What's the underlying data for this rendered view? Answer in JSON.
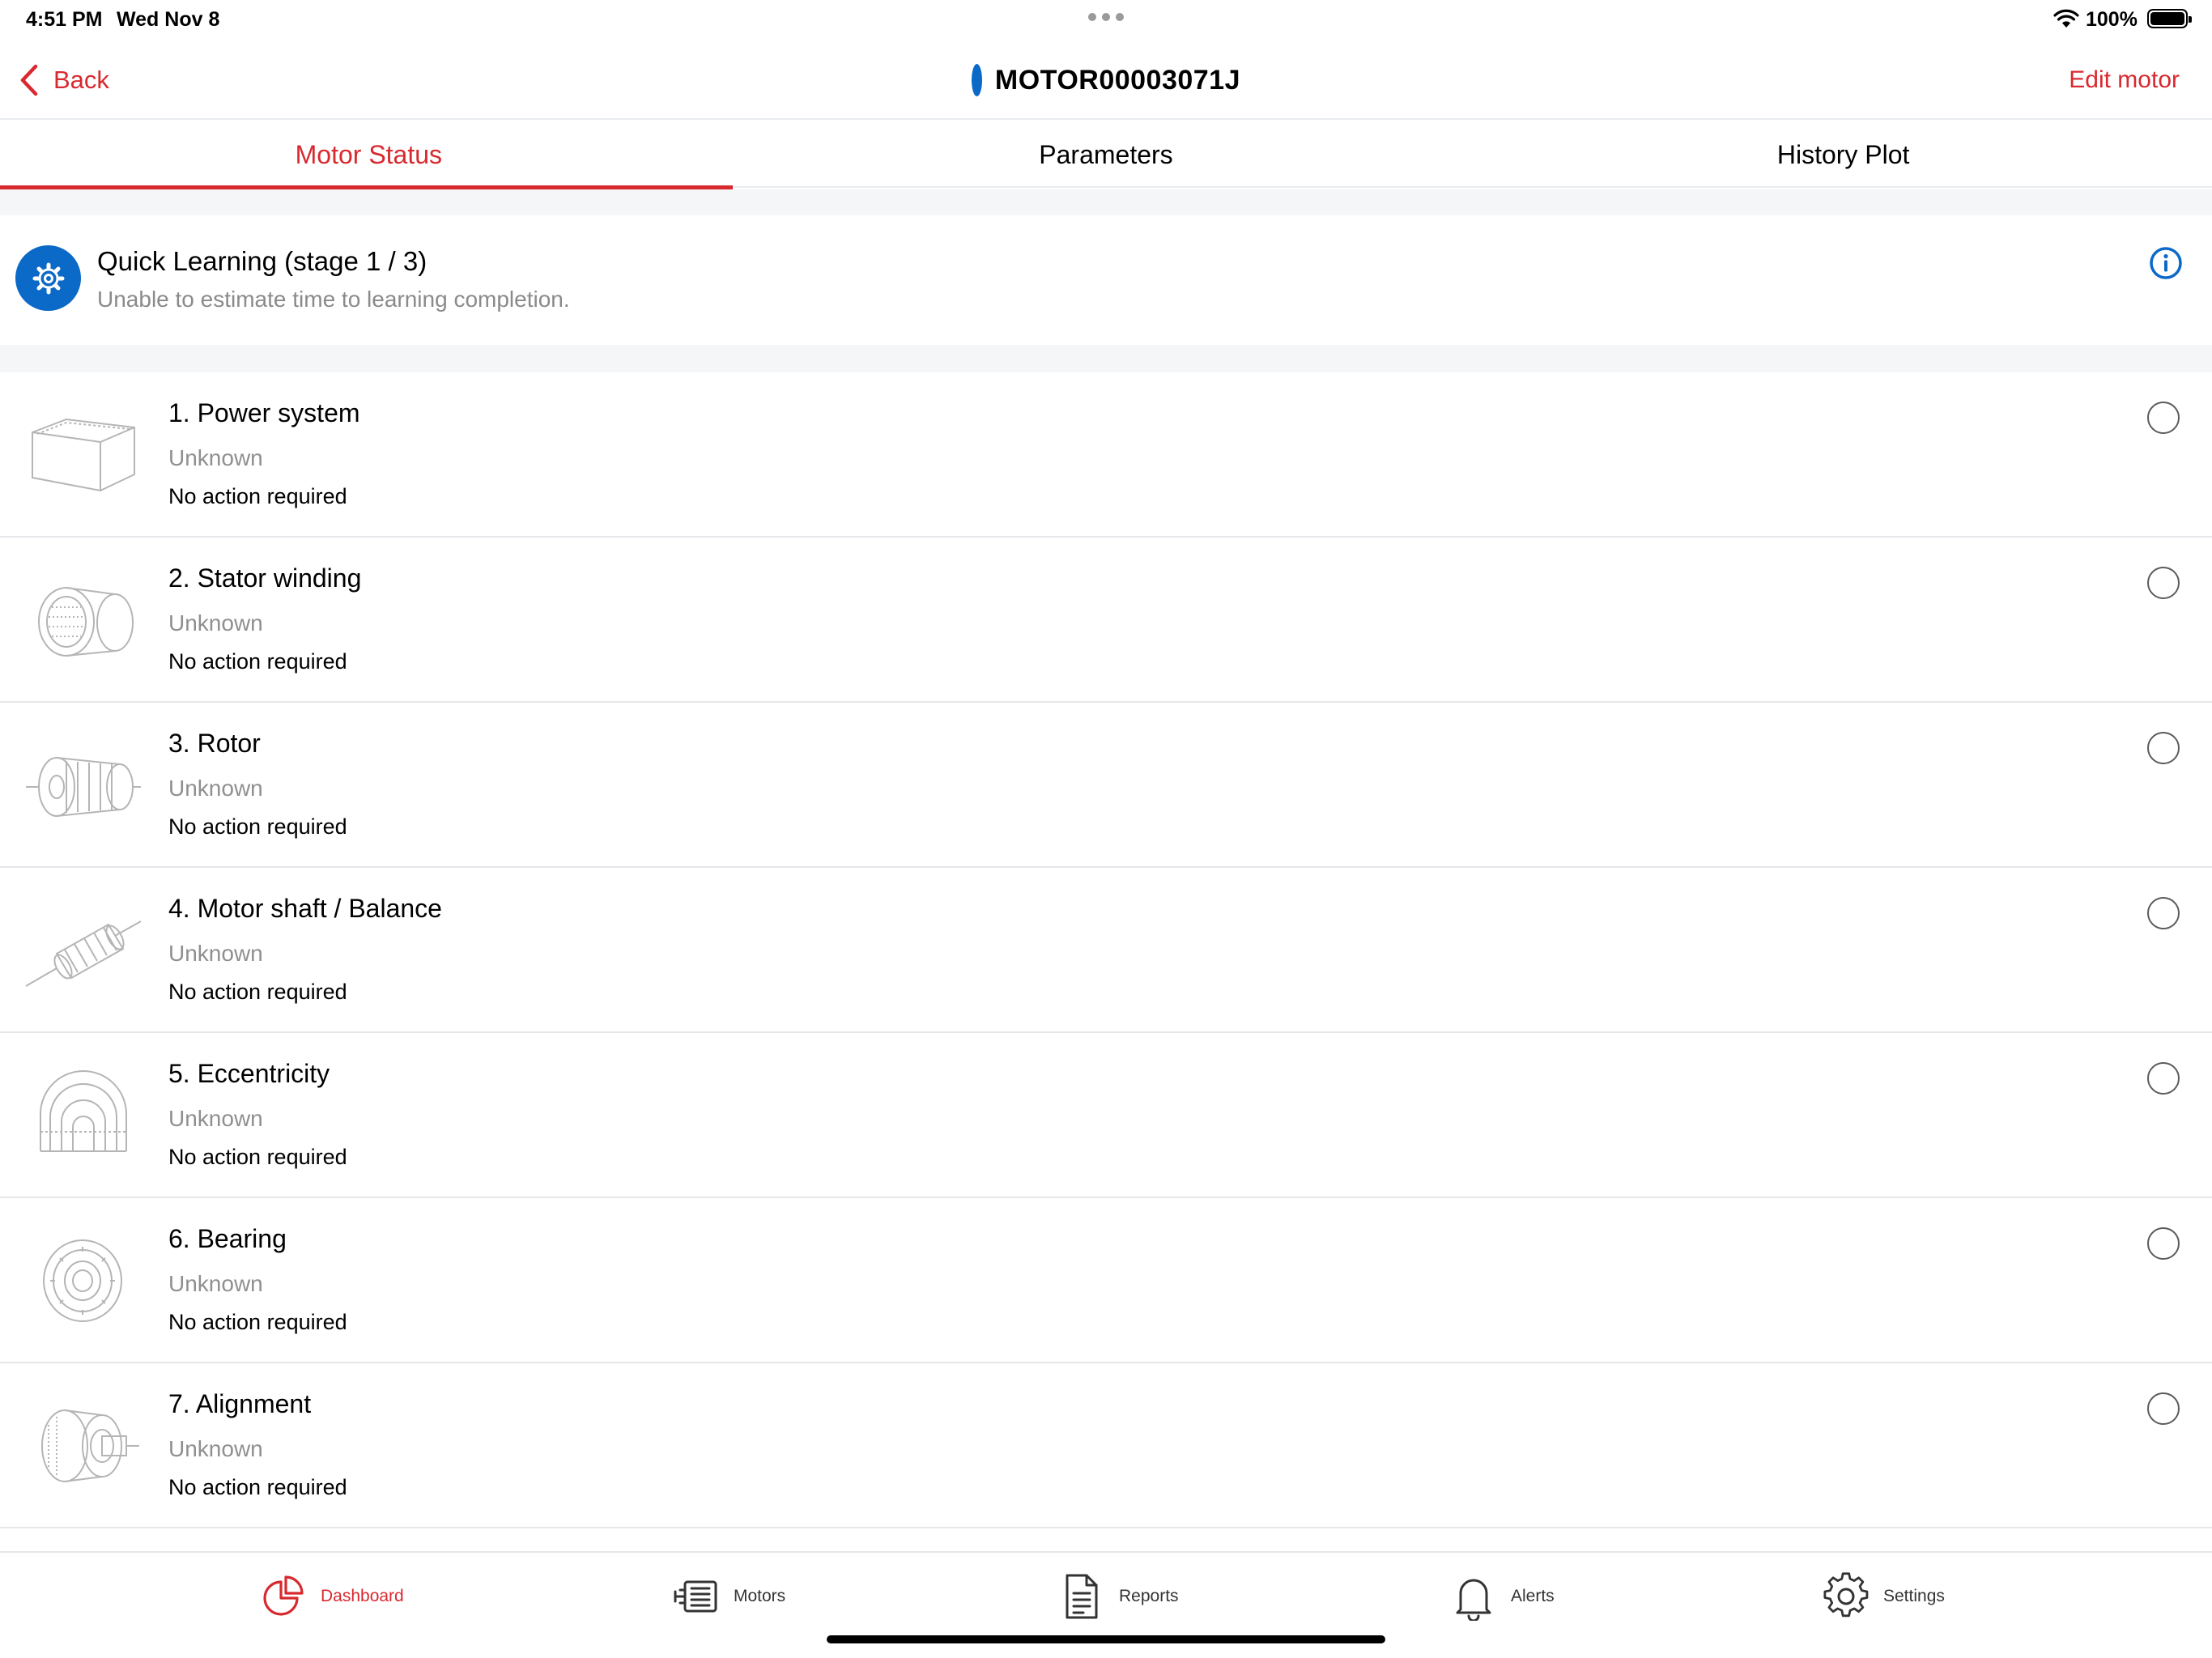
{
  "status_bar": {
    "time": "4:51 PM",
    "date": "Wed Nov 8",
    "battery": "100%"
  },
  "nav": {
    "back_label": "Back",
    "title": "MOTOR00003071J",
    "status_color": "#0b69c7",
    "edit_label": "Edit motor"
  },
  "tabs": [
    {
      "label": "Motor Status",
      "active": true
    },
    {
      "label": "Parameters",
      "active": false
    },
    {
      "label": "History Plot",
      "active": false
    }
  ],
  "learning": {
    "title": "Quick Learning (stage 1 / 3)",
    "subtitle": "Unable to estimate time to learning completion.",
    "icon": "gear-icon"
  },
  "items": [
    {
      "title": "1. Power system",
      "status": "Unknown",
      "action": "No action required",
      "icon": "power-system-icon"
    },
    {
      "title": "2. Stator winding",
      "status": "Unknown",
      "action": "No action required",
      "icon": "stator-icon"
    },
    {
      "title": "3. Rotor",
      "status": "Unknown",
      "action": "No action required",
      "icon": "rotor-icon"
    },
    {
      "title": "4. Motor shaft / Balance",
      "status": "Unknown",
      "action": "No action required",
      "icon": "shaft-icon"
    },
    {
      "title": "5. Eccentricity",
      "status": "Unknown",
      "action": "No action required",
      "icon": "eccentricity-icon"
    },
    {
      "title": "6. Bearing",
      "status": "Unknown",
      "action": "No action required",
      "icon": "bearing-icon"
    },
    {
      "title": "7. Alignment",
      "status": "Unknown",
      "action": "No action required",
      "icon": "alignment-icon"
    }
  ],
  "tab_bar": [
    {
      "label": "Dashboard",
      "icon": "dashboard-icon",
      "active": true
    },
    {
      "label": "Motors",
      "icon": "motors-icon",
      "active": false
    },
    {
      "label": "Reports",
      "icon": "reports-icon",
      "active": false
    },
    {
      "label": "Alerts",
      "icon": "bell-icon",
      "active": false
    },
    {
      "label": "Settings",
      "icon": "gear-icon",
      "active": false
    }
  ],
  "colors": {
    "accent": "#d8292f",
    "brand_blue": "#0b69c7"
  }
}
